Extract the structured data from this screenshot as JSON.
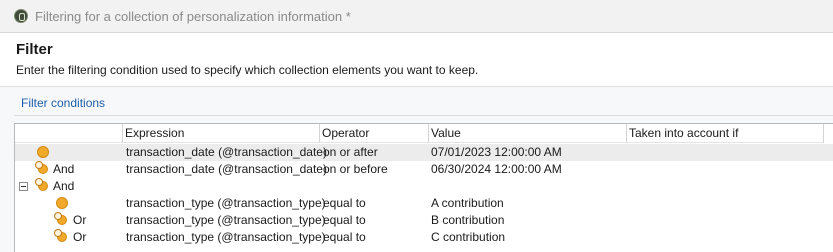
{
  "window": {
    "title": "Filtering for a collection of personalization information *"
  },
  "header": {
    "title": "Filter",
    "description": "Enter the filtering condition used to specify which collection elements you want to keep."
  },
  "section": {
    "link_label": "Filter conditions"
  },
  "tree": {
    "columns": [
      "Expression",
      "Operator",
      "Value",
      "Taken into account if"
    ],
    "rows": [
      {
        "connector": "",
        "expression": "transaction_date (@transaction_date)",
        "operator": "on or after",
        "value": "07/01/2023 12:00:00 AM",
        "taken_into_account": "",
        "icon": "condition-icon",
        "selected": true
      },
      {
        "connector": "And",
        "expression": "transaction_date (@transaction_date)",
        "operator": "on or before",
        "value": "06/30/2024 12:00:00 AM",
        "taken_into_account": "",
        "icon": "linked-condition-icon",
        "selected": false
      },
      {
        "connector": "And",
        "expression": "",
        "operator": "",
        "value": "",
        "taken_into_account": "",
        "icon": "linked-condition-icon",
        "group": true,
        "expanded": true
      },
      {
        "connector": "",
        "expression": "transaction_type (@transaction_type)",
        "operator": "equal to",
        "value": "A contribution",
        "taken_into_account": "",
        "icon": "condition-icon"
      },
      {
        "connector": "Or",
        "expression": "transaction_type (@transaction_type)",
        "operator": "equal to",
        "value": "B contribution",
        "taken_into_account": "",
        "icon": "linked-condition-icon"
      },
      {
        "connector": "Or",
        "expression": "transaction_type (@transaction_type)",
        "operator": "equal to",
        "value": "C contribution",
        "taken_into_account": "",
        "icon": "linked-condition-icon"
      }
    ]
  },
  "colors": {
    "link": "#1f5fa8",
    "condition_icon": "#f0a92a",
    "selected_row": "#ececec"
  }
}
